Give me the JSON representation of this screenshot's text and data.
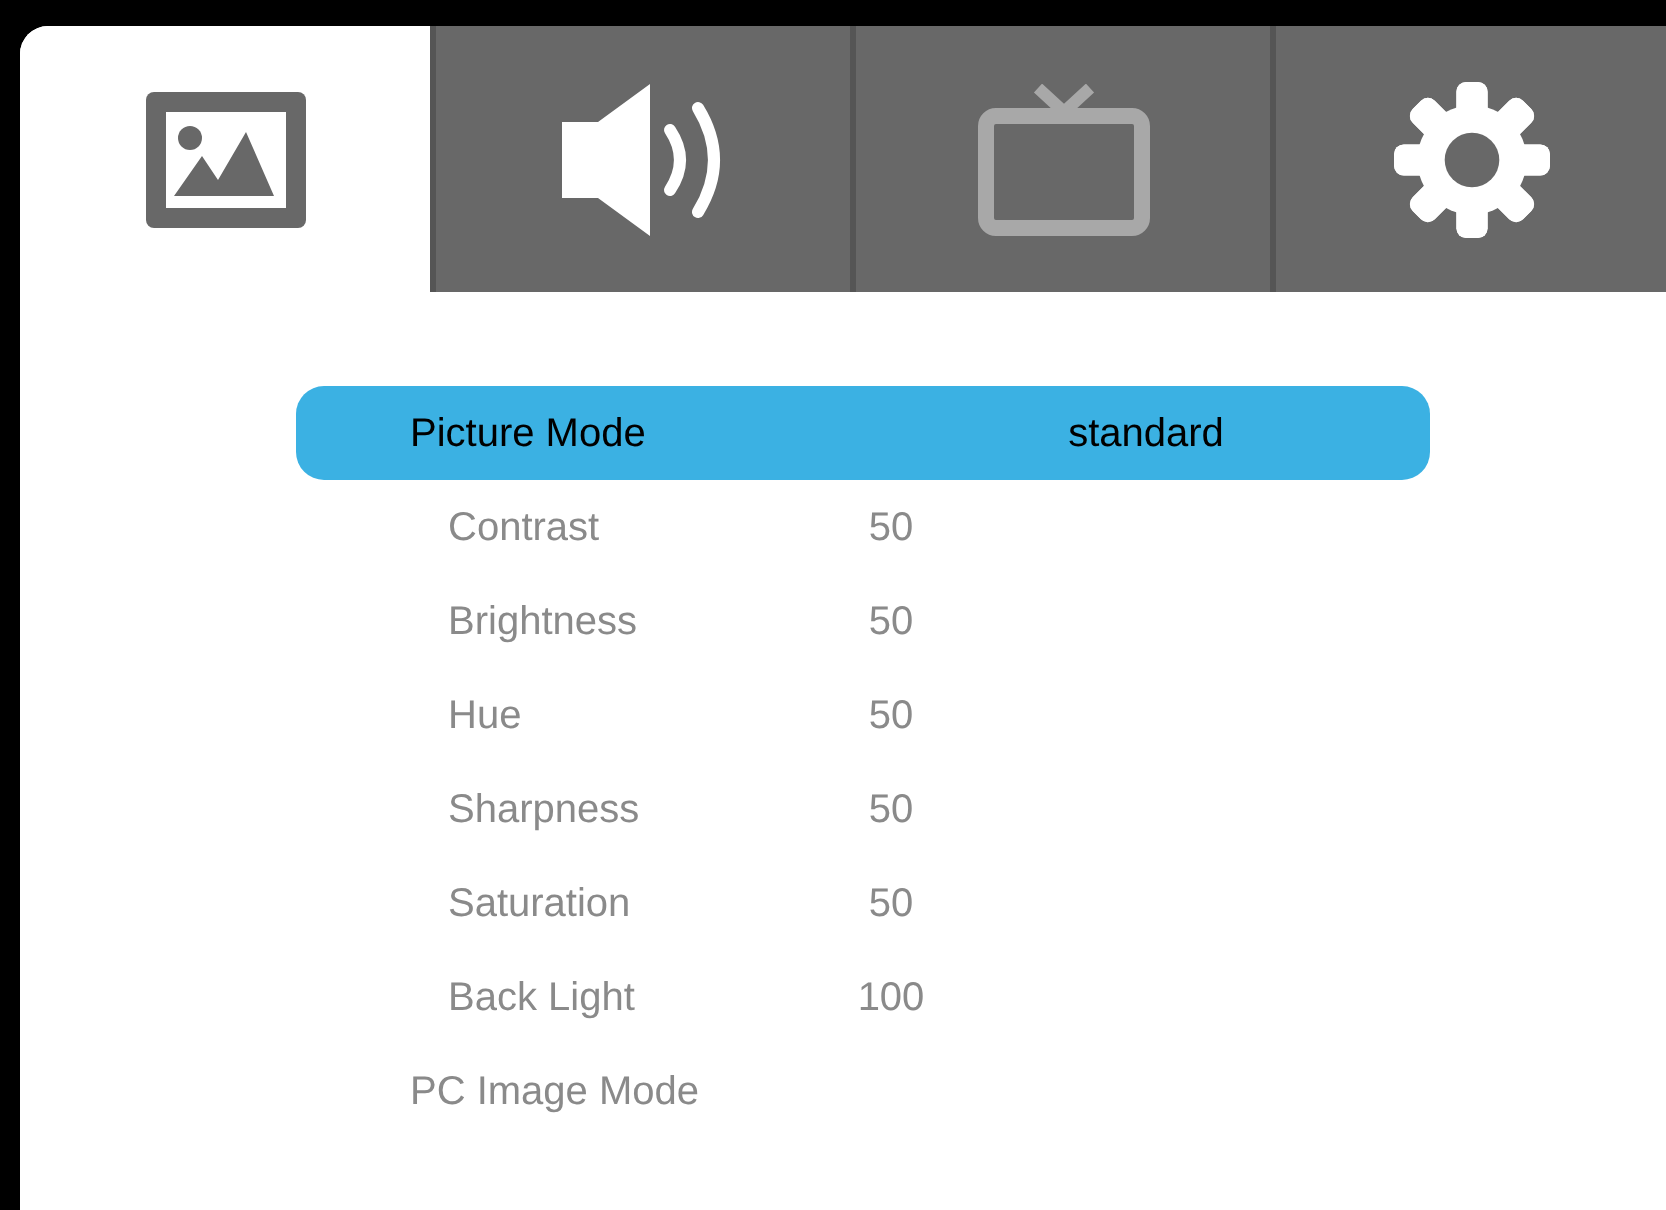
{
  "tabs": [
    {
      "kind": "picture",
      "selected": true,
      "disabled": false
    },
    {
      "kind": "sound",
      "selected": false,
      "disabled": false
    },
    {
      "kind": "tv",
      "selected": false,
      "disabled": true
    },
    {
      "kind": "settings",
      "selected": false,
      "disabled": false
    }
  ],
  "menu": [
    {
      "label": "Picture Mode",
      "value": "standard",
      "selected": true,
      "children": [
        {
          "label": "Contrast",
          "value": "50",
          "selected": false
        },
        {
          "label": "Brightness",
          "value": "50",
          "selected": false
        },
        {
          "label": "Hue",
          "value": "50",
          "selected": false
        },
        {
          "label": "Sharpness",
          "value": "50",
          "selected": false
        },
        {
          "label": "Saturation",
          "value": "50",
          "selected": false
        },
        {
          "label": "Back Light",
          "value": "100",
          "selected": false
        }
      ]
    },
    {
      "label": "PC Image Mode",
      "selected": false
    }
  ]
}
